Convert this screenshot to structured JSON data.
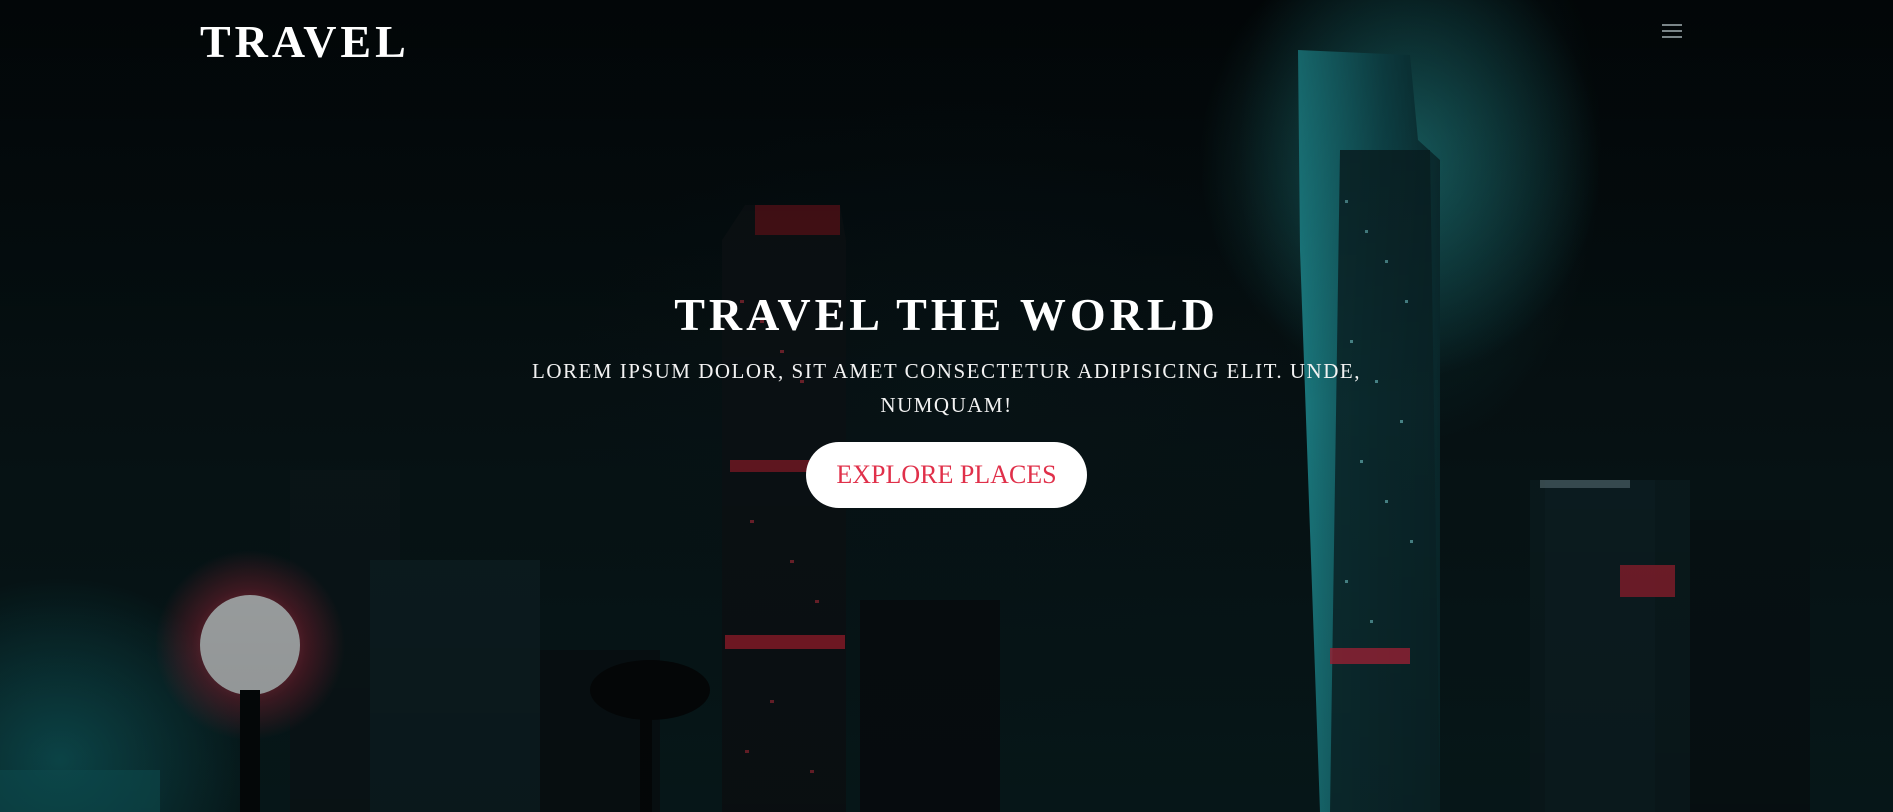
{
  "header": {
    "logo_text": "TRAVEL",
    "menu_icon": "hamburger-menu-icon"
  },
  "hero": {
    "title": "TRAVEL THE WORLD",
    "subtitle": "LOREM IPSUM DOLOR, SIT AMET CONSECTETUR ADIPISICING ELIT. UNDE, NUMQUAM!",
    "cta_label": "EXPLORE PLACES",
    "background_image": "night city skyline with teal and red lights"
  },
  "colors": {
    "cta_text": "#e0304a",
    "cta_background": "#ffffff",
    "text": "#ffffff",
    "background": "#02090b",
    "accent_teal": "#16868a"
  }
}
